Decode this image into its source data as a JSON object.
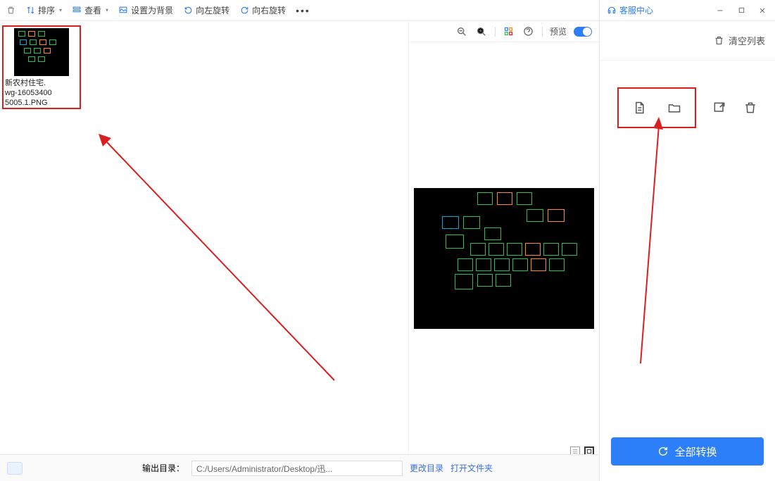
{
  "toolbar": {
    "sort": "排序",
    "view": "查看",
    "set_wallpaper": "设置为背景",
    "rotate_left": "向左旋转",
    "rotate_right": "向右旋转",
    "preview": "预览",
    "service_center": "客服中心"
  },
  "thumbnail": {
    "line1": "新农村住宅.",
    "line2": "wg-16053400",
    "line3": "5005.1.PNG"
  },
  "preview_bar": {
    "label": "预览"
  },
  "bottom": {
    "out_dir_label": "输出目录：",
    "out_dir_value": "C:/Users/Administrator/Desktop/迅...",
    "change_dir": "更改目录",
    "open_folder": "打开文件夹"
  },
  "side": {
    "clear_list": "清空列表",
    "convert_all": "全部转换"
  }
}
